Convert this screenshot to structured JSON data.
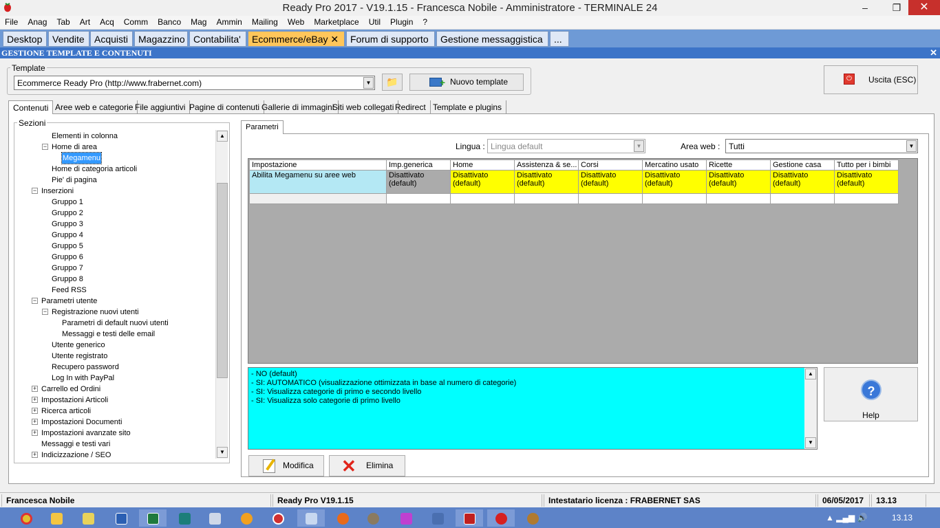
{
  "window": {
    "title": "Ready Pro 2017 - V19.1.15 - Francesca Nobile - Amministratore - TERMINALE 24",
    "minimize": "–",
    "restore": "❐",
    "close": "✕"
  },
  "menubar": [
    "File",
    "Anag",
    "Tab",
    "Art",
    "Acq",
    "Comm",
    "Banco",
    "Mag",
    "Ammin",
    "Mailing",
    "Web",
    "Marketplace",
    "Util",
    "Plugin",
    "?"
  ],
  "module_tabs": [
    {
      "label": "Desktop"
    },
    {
      "label": "Vendite"
    },
    {
      "label": "Acquisti"
    },
    {
      "label": "Magazzino"
    },
    {
      "label": "Contabilita'"
    },
    {
      "label": "Ecommerce/eBay ✕"
    },
    {
      "label": "Forum di supporto"
    },
    {
      "label": "Gestione messaggistica"
    },
    {
      "label": "..."
    }
  ],
  "section_header": {
    "title": "GESTIONE TEMPLATE E CONTENUTI",
    "close": "✕"
  },
  "template": {
    "label": "Template",
    "selected": "Ecommerce Ready Pro (http://www.frabernet.com)",
    "new_button": "Nuovo template"
  },
  "exit_button": "Uscita (ESC)",
  "sub_tabs": [
    "Contenuti",
    "Aree web e categorie",
    "File aggiuntivi",
    "Pagine di contenuti",
    "Gallerie di immagini",
    "Siti web collegati",
    "Redirect",
    "Template e plugins"
  ],
  "sections": {
    "label": "Sezioni",
    "tree": [
      {
        "label": "Elementi in colonna",
        "lvl": 2
      },
      {
        "label": "Home di area",
        "lvl": 2,
        "exp": "−"
      },
      {
        "label": "Megamenu",
        "lvl": 3,
        "sel": true
      },
      {
        "label": "Home di categoria articoli",
        "lvl": 2
      },
      {
        "label": "Pie' di pagina",
        "lvl": 2
      },
      {
        "label": "Inserzioni",
        "lvl": 1,
        "exp": "−"
      },
      {
        "label": "Gruppo 1",
        "lvl": 2
      },
      {
        "label": "Gruppo 2",
        "lvl": 2
      },
      {
        "label": "Gruppo 3",
        "lvl": 2
      },
      {
        "label": "Gruppo 4",
        "lvl": 2
      },
      {
        "label": "Gruppo 5",
        "lvl": 2
      },
      {
        "label": "Gruppo 6",
        "lvl": 2
      },
      {
        "label": "Gruppo 7",
        "lvl": 2
      },
      {
        "label": "Gruppo 8",
        "lvl": 2
      },
      {
        "label": "Feed RSS",
        "lvl": 2
      },
      {
        "label": "Parametri utente",
        "lvl": 1,
        "exp": "−"
      },
      {
        "label": "Registrazione nuovi utenti",
        "lvl": 2,
        "exp": "−"
      },
      {
        "label": "Parametri di default nuovi utenti",
        "lvl": 3
      },
      {
        "label": "Messaggi e testi delle email",
        "lvl": 3
      },
      {
        "label": "Utente generico",
        "lvl": 2
      },
      {
        "label": "Utente registrato",
        "lvl": 2
      },
      {
        "label": "Recupero password",
        "lvl": 2
      },
      {
        "label": "Log In with PayPal",
        "lvl": 2
      },
      {
        "label": "Carrello ed Ordini",
        "lvl": 1,
        "exp": "+"
      },
      {
        "label": "Impostazioni Articoli",
        "lvl": 1,
        "exp": "+"
      },
      {
        "label": "Ricerca articoli",
        "lvl": 1,
        "exp": "+"
      },
      {
        "label": "Impostazioni Documenti",
        "lvl": 1,
        "exp": "+"
      },
      {
        "label": "Impostazioni avanzate sito",
        "lvl": 1,
        "exp": "+"
      },
      {
        "label": "Messaggi e testi vari",
        "lvl": 1
      },
      {
        "label": "Indicizzazione / SEO",
        "lvl": 1,
        "exp": "+"
      }
    ]
  },
  "params": {
    "tab": "Parametri",
    "lingua_label": "Lingua :",
    "lingua_value": "Lingua default",
    "area_label": "Area web :",
    "area_value": "Tutti",
    "columns": [
      "Impostazione",
      "Imp.generica",
      "Home",
      "Assistenza & se...",
      "Corsi",
      "Mercatino usato",
      "Ricette",
      "Gestione casa",
      "Tutto per i bimbi"
    ],
    "row": {
      "setting": "Abilita Megamenu su aree web",
      "generic": [
        "Disattivato",
        "(default)"
      ],
      "cells": [
        [
          "Disattivato",
          "(default)"
        ],
        [
          "Disattivato",
          "(default)"
        ],
        [
          "Disattivato",
          "(default)"
        ],
        [
          "Disattivato",
          "(default)"
        ],
        [
          "Disattivato",
          "(default)"
        ],
        [
          "Disattivato",
          "(default)"
        ],
        [
          "Disattivato",
          "(default)"
        ]
      ]
    },
    "description": [
      "- NO (default)",
      "- SI: AUTOMATICO (visualizzazione ottimizzata in base al numero di categorie)",
      "- SI: Visualizza categorie di primo e secondo livello",
      "- SI: Visualizza solo categorie di primo livello"
    ],
    "help_button": "Help",
    "modify_button": "Modifica",
    "delete_button": "Elimina"
  },
  "statusbar": {
    "user": "Francesca Nobile",
    "version": "Ready Pro V19.1.15",
    "license": "Intestatario licenza : FRABERNET SAS",
    "date": "06/05/2017",
    "time": "13.13"
  },
  "taskbar": {
    "clock": "13.13",
    "tray": "▲ ▂▄▆ 🔊"
  }
}
